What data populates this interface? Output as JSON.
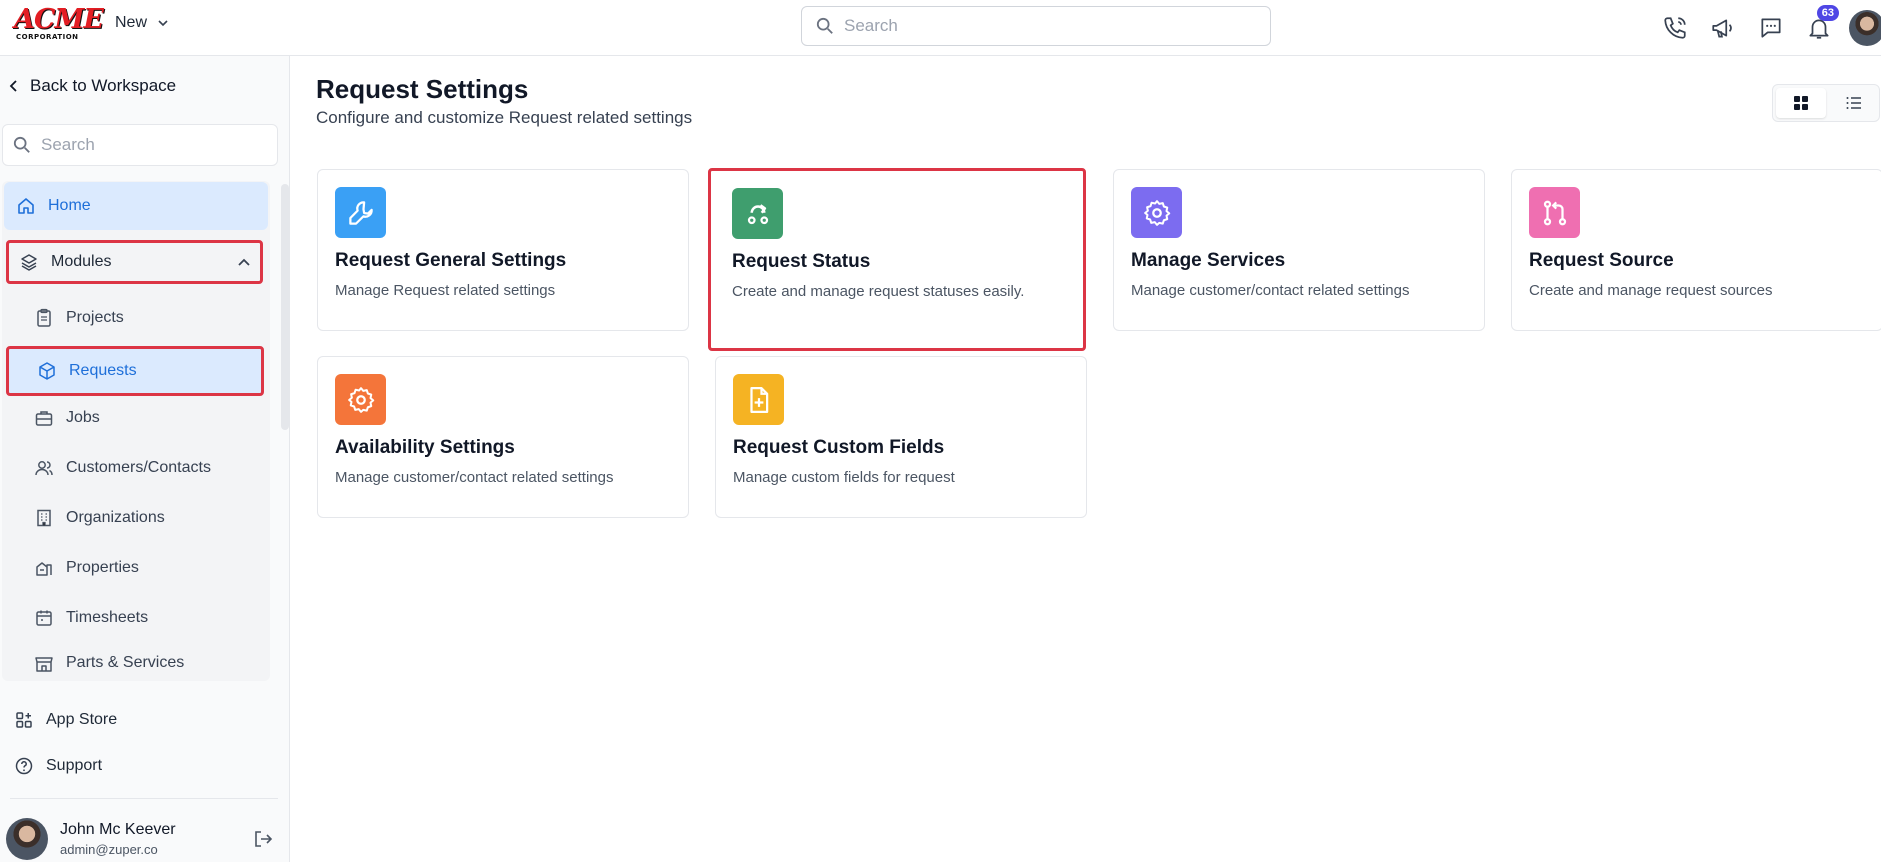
{
  "topbar": {
    "logo_text": "ACME",
    "logo_subtext": "CORPORATION",
    "new_label": "New",
    "search_placeholder": "Search",
    "notification_count": "63"
  },
  "sidebar": {
    "back_label": "Back to Workspace",
    "search_placeholder": "Search",
    "home_label": "Home",
    "modules_label": "Modules",
    "items": [
      {
        "label": "Projects"
      },
      {
        "label": "Requests"
      },
      {
        "label": "Jobs"
      },
      {
        "label": "Customers/Contacts"
      },
      {
        "label": "Organizations"
      },
      {
        "label": "Properties"
      },
      {
        "label": "Timesheets"
      },
      {
        "label": "Parts & Services"
      }
    ],
    "app_store_label": "App Store",
    "support_label": "Support",
    "user": {
      "name": "John Mc Keever",
      "email": "admin@zuper.co"
    }
  },
  "main": {
    "title": "Request Settings",
    "subtitle": "Configure and customize Request related settings",
    "cards": [
      {
        "title": "Request General Settings",
        "desc": "Manage Request related settings",
        "icon": "wrench-icon",
        "color": "#3aa0f5"
      },
      {
        "title": "Request Status",
        "desc": "Create and manage request statuses easily.",
        "icon": "status-flow-icon",
        "color": "#3f9e6e"
      },
      {
        "title": "Manage Services",
        "desc": "Manage customer/contact related settings",
        "icon": "gear-icon",
        "color": "#7c6cf0"
      },
      {
        "title": "Request Source",
        "desc": "Create and manage request sources",
        "icon": "git-pull-icon",
        "color": "#ef6fb1"
      },
      {
        "title": "Availability Settings",
        "desc": "Manage customer/contact related settings",
        "icon": "gear-bolt-icon",
        "color": "#f4753a"
      },
      {
        "title": "Request Custom Fields",
        "desc": "Manage custom fields for request",
        "icon": "file-plus-icon",
        "color": "#f5b323"
      }
    ]
  }
}
